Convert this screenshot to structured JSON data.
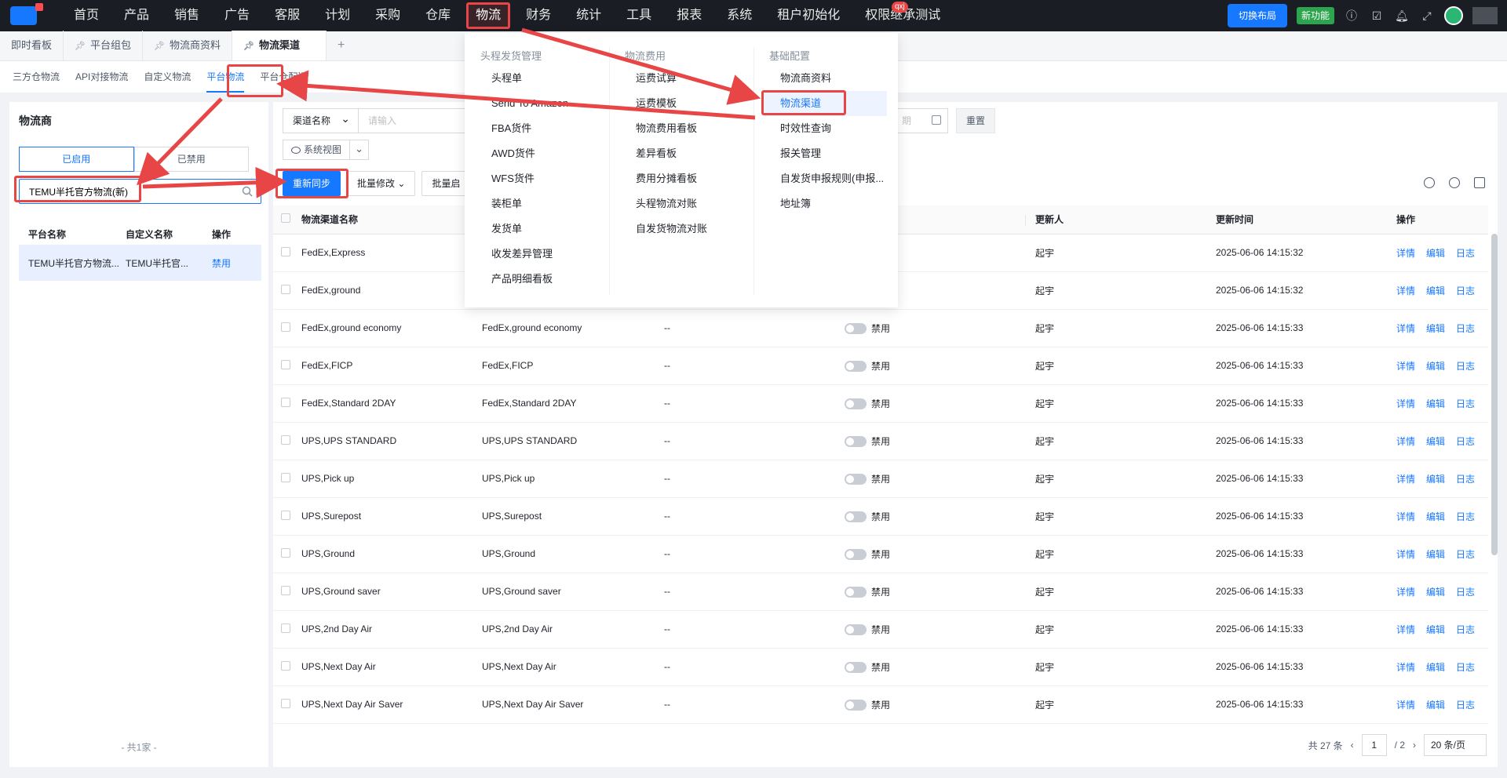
{
  "nav": {
    "items": [
      "首页",
      "产品",
      "销售",
      "广告",
      "客服",
      "计划",
      "采购",
      "仓库",
      "物流",
      "财务",
      "统计",
      "工具",
      "报表",
      "系统",
      "租户初始化",
      "权限继承测试"
    ],
    "active": "物流",
    "badge": "qxj",
    "switch_layout": "切换布局",
    "new_feature": "新功能"
  },
  "page_tabs": [
    {
      "label": "即时看板"
    },
    {
      "label": "平台组包"
    },
    {
      "label": "物流商资料"
    },
    {
      "label": "物流渠道"
    }
  ],
  "sub_tabs": [
    "三方仓物流",
    "API对接物流",
    "自定义物流",
    "平台物流",
    "平台仓配送"
  ],
  "left": {
    "title": "物流商",
    "seg_enabled": "已启用",
    "seg_disabled": "已禁用",
    "search_value": "TEMU半托官方物流(新)",
    "headers": [
      "平台名称",
      "自定义名称",
      "操作"
    ],
    "row": {
      "platform": "TEMU半托官方物流...",
      "custom": "TEMU半托官...",
      "action": "禁用"
    },
    "footer": "- 共1家 -"
  },
  "filter": {
    "select_label": "渠道名称",
    "input_placeholder": "请输入",
    "date_placeholder": "期",
    "reset": "重置",
    "sys_view": "系统视图"
  },
  "actions": {
    "resync": "重新同步",
    "batch_edit": "批量修改",
    "batch_enable": "批量启"
  },
  "table": {
    "headers": [
      "物流渠道名称",
      "更新人",
      "更新时间",
      "操作"
    ],
    "toggle_label": "禁用",
    "ops": [
      "详情",
      "编辑",
      "日志"
    ],
    "rows": [
      {
        "name": "FedEx,Express",
        "custom": "",
        "desc": "",
        "updater": "起宇",
        "time": "2025-06-06 14:15:32"
      },
      {
        "name": "FedEx,ground",
        "custom": "",
        "desc": "",
        "updater": "起宇",
        "time": "2025-06-06 14:15:32"
      },
      {
        "name": "FedEx,ground economy",
        "custom": "FedEx,ground economy",
        "desc": "--",
        "updater": "起宇",
        "time": "2025-06-06 14:15:33"
      },
      {
        "name": "FedEx,FICP",
        "custom": "FedEx,FICP",
        "desc": "--",
        "updater": "起宇",
        "time": "2025-06-06 14:15:33"
      },
      {
        "name": "FedEx,Standard 2DAY",
        "custom": "FedEx,Standard 2DAY",
        "desc": "--",
        "updater": "起宇",
        "time": "2025-06-06 14:15:33"
      },
      {
        "name": "UPS,UPS STANDARD",
        "custom": "UPS,UPS STANDARD",
        "desc": "--",
        "updater": "起宇",
        "time": "2025-06-06 14:15:33"
      },
      {
        "name": "UPS,Pick up",
        "custom": "UPS,Pick up",
        "desc": "--",
        "updater": "起宇",
        "time": "2025-06-06 14:15:33"
      },
      {
        "name": "UPS,Surepost",
        "custom": "UPS,Surepost",
        "desc": "--",
        "updater": "起宇",
        "time": "2025-06-06 14:15:33"
      },
      {
        "name": "UPS,Ground",
        "custom": "UPS,Ground",
        "desc": "--",
        "updater": "起宇",
        "time": "2025-06-06 14:15:33"
      },
      {
        "name": "UPS,Ground saver",
        "custom": "UPS,Ground saver",
        "desc": "--",
        "updater": "起宇",
        "time": "2025-06-06 14:15:33"
      },
      {
        "name": "UPS,2nd Day Air",
        "custom": "UPS,2nd Day Air",
        "desc": "--",
        "updater": "起宇",
        "time": "2025-06-06 14:15:33"
      },
      {
        "name": "UPS,Next Day Air",
        "custom": "UPS,Next Day Air",
        "desc": "--",
        "updater": "起宇",
        "time": "2025-06-06 14:15:33"
      },
      {
        "name": "UPS,Next Day Air Saver",
        "custom": "UPS,Next Day Air Saver",
        "desc": "--",
        "updater": "起宇",
        "time": "2025-06-06 14:15:33"
      }
    ]
  },
  "pager": {
    "total": "共 27 条",
    "current": "1",
    "pages": "/ 2",
    "size": "20 条/页"
  },
  "mega_menu": {
    "col1": {
      "title": "头程发货管理",
      "items": [
        "头程单",
        "Send To Amazon",
        "FBA货件",
        "AWD货件",
        "WFS货件",
        "装柜单",
        "发货单",
        "收发差异管理",
        "产品明细看板"
      ]
    },
    "col2": {
      "title": "物流费用",
      "items": [
        "运费试算",
        "运费模板",
        "物流费用看板",
        "差异看板",
        "费用分摊看板",
        "头程物流对账",
        "自发货物流对账"
      ]
    },
    "col3": {
      "title": "基础配置",
      "items": [
        "物流商资料",
        "物流渠道",
        "时效性查询",
        "报关管理",
        "自发货申报规则(申报...",
        "地址簿"
      ]
    },
    "selected": "物流渠道"
  },
  "colors": {
    "accent": "#1677ff",
    "annotation": "#e84646",
    "nav_bg": "#1a1d24"
  }
}
